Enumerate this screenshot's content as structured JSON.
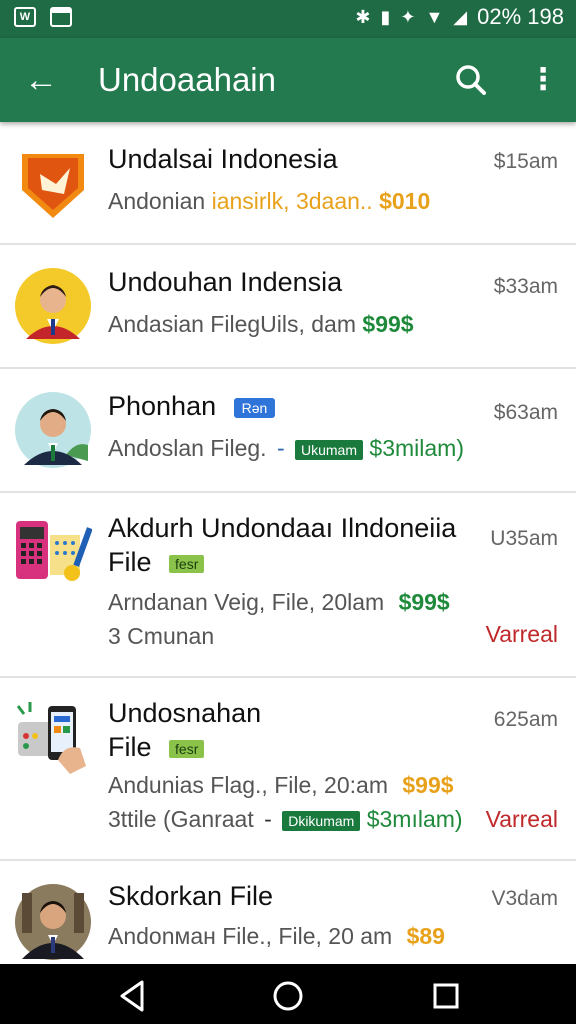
{
  "status": {
    "left1": "W",
    "left2": "",
    "right_text": "02% 198"
  },
  "appbar": {
    "title": "Undoaahain"
  },
  "rows": [
    {
      "name": "Undalsai Indonesia",
      "time": "$15am",
      "sub": "Andonian",
      "sub_highlight": "iansirlk, 3daan..",
      "price": "$010"
    },
    {
      "name": "Undouhan Indensia",
      "time": "$33am",
      "sub": "Andasian FilegUils, dam",
      "price": "$99$"
    },
    {
      "name": "Phonhan",
      "tag": "Rən",
      "time": "$63am",
      "sub": "Andoslan Fileg.",
      "dash": "-",
      "tag2": "Ukumam",
      "price": "$3milam)"
    },
    {
      "name": "Akdurh Undondaaı Ilndoneiia",
      "name2": "File",
      "tag": "fesr",
      "time": "U35am",
      "sub": "Arndanan Veig, File, 20lam",
      "price": "$99$",
      "sub2": "3 Cmunan",
      "status": "Varreal"
    },
    {
      "name": "Undosnahan",
      "name2": "File",
      "tag": "fesr",
      "time": "625am",
      "sub": "Andunias Flag., File, 20:am",
      "price": "$99$",
      "sub2": "3ttile (Ganraat",
      "dash": "-",
      "tag2": "Dkikumam",
      "price2": "$3mılam)",
      "status": "Varreal"
    },
    {
      "name": "Skdorkan File",
      "time": "V3dam",
      "sub": "Andonман File., File, 20 am",
      "price": "$89"
    }
  ]
}
